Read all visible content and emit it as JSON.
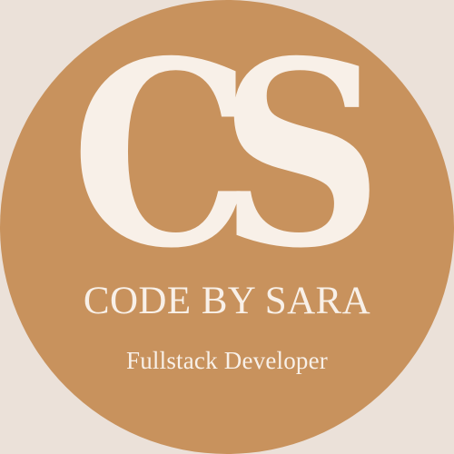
{
  "logo": {
    "monogram_c": "C",
    "monogram_s": "S",
    "brand_name": "CODE BY SARA",
    "tagline": "Fullstack Developer",
    "colors": {
      "background": "#ebe1d9",
      "badge": "#c8925d",
      "text": "#f8f0e8"
    }
  }
}
